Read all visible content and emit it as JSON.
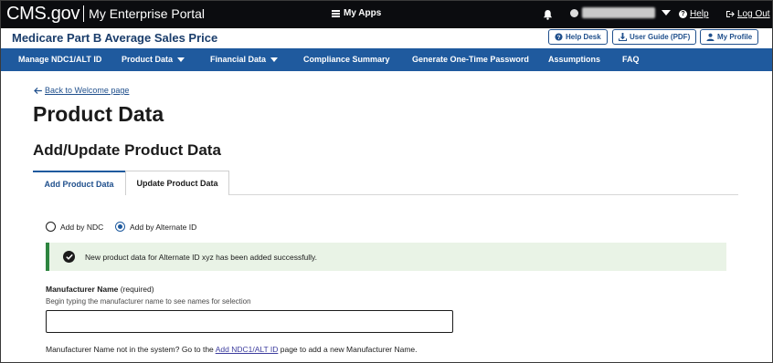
{
  "header": {
    "brand": "CMS.gov",
    "portal": "My Enterprise Portal",
    "my_apps": "My Apps",
    "help": "Help",
    "logout": "Log Out",
    "icons": [
      "grid-icon",
      "bell-icon",
      "user-icon",
      "help-icon",
      "logout-icon"
    ]
  },
  "titlebar": {
    "app_title": "Medicare Part B Average Sales Price",
    "help_desk": "Help Desk",
    "user_guide": "User Guide (PDF)",
    "my_profile": "My Profile"
  },
  "nav": {
    "items": [
      {
        "label": "Manage NDC1/ALT ID"
      },
      {
        "label": "Product Data"
      },
      {
        "label": "Financial Data"
      },
      {
        "label": "Compliance Summary"
      },
      {
        "label": "Generate One-Time Password"
      },
      {
        "label": "Assumptions"
      },
      {
        "label": "FAQ"
      }
    ]
  },
  "main": {
    "back_link": "Back to Welcome page",
    "page_title": "Product Data",
    "section_title": "Add/Update Product Data",
    "tabs": [
      {
        "label": "Add Product Data",
        "active": true
      },
      {
        "label": "Update Product Data",
        "active": false
      }
    ],
    "radios": [
      {
        "label": "Add by NDC",
        "checked": false
      },
      {
        "label": "Add by Alternate ID",
        "checked": true
      }
    ],
    "alert": {
      "message": "New product data for Alternate ID xyz has been added successfully.",
      "color": "#2e8540"
    },
    "manufacturer": {
      "label": "Manufacturer Name",
      "required": "(required)",
      "hint": "Begin typing the manufacturer name to see names for selection",
      "value": "",
      "note_prefix": "Manufacturer Name not in the system? Go to the",
      "note_link": "Add NDC1/ALT ID",
      "note_suffix": "page to add a new Manufacturer Name."
    }
  },
  "colors": {
    "topbar": "#0b0c0f",
    "nav": "#1f5a9e",
    "accent": "#1f4f8c",
    "title": "#1a3d6b"
  }
}
